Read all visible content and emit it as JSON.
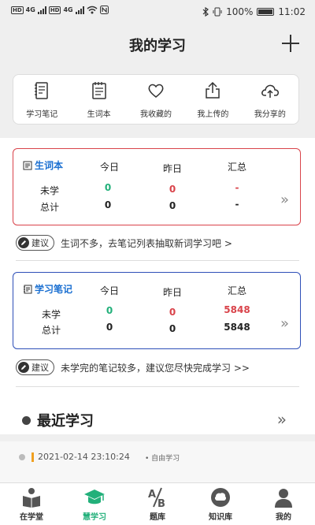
{
  "status_bar": {
    "left_labels": [
      "HD",
      "4G",
      "HD",
      "4G"
    ],
    "battery": "100%",
    "time": "11:02"
  },
  "header": {
    "title": "我的学习",
    "add_icon": "plus-icon"
  },
  "quick_actions": [
    {
      "label": "学习笔记",
      "icon": "notebook-icon"
    },
    {
      "label": "生词本",
      "icon": "vocabulary-icon"
    },
    {
      "label": "我收藏的",
      "icon": "heart-icon"
    },
    {
      "label": "我上传的",
      "icon": "upload-icon"
    },
    {
      "label": "我分享的",
      "icon": "cloud-share-icon"
    }
  ],
  "vocab_card": {
    "title": "生词本",
    "columns": [
      "今日",
      "昨日",
      "汇总"
    ],
    "rows": [
      {
        "label": "未学",
        "values": [
          "0",
          "0",
          "-"
        ]
      },
      {
        "label": "总计",
        "values": [
          "0",
          "0",
          "-"
        ]
      }
    ],
    "accent": "#d9434a"
  },
  "vocab_tip": {
    "badge": "建议",
    "text": "生词不多，去笔记列表抽取新词学习吧 >"
  },
  "notes_card": {
    "title": "学习笔记",
    "columns": [
      "今日",
      "昨日",
      "汇总"
    ],
    "rows": [
      {
        "label": "未学",
        "values": [
          "0",
          "0",
          "5848"
        ]
      },
      {
        "label": "总计",
        "values": [
          "0",
          "0",
          "5848"
        ]
      }
    ],
    "accent": "#2e4fb8"
  },
  "notes_tip": {
    "badge": "建议",
    "text": "未学完的笔记较多，建议您尽快完成学习 >>"
  },
  "recent": {
    "title": "最近学习",
    "entry_time": "2021-02-14 23:10:24",
    "entry_tag": "自由学习"
  },
  "bottom_nav": [
    {
      "label": "在学堂",
      "icon": "reader-icon",
      "active": false
    },
    {
      "label": "慧学习",
      "icon": "graduation-cap-icon",
      "active": true
    },
    {
      "label": "题库",
      "icon": "ab-icon",
      "active": false
    },
    {
      "label": "知识库",
      "icon": "brain-icon",
      "active": false
    },
    {
      "label": "我的",
      "icon": "person-icon",
      "active": false
    }
  ],
  "colors": {
    "green": "#22b07a",
    "red": "#d9434a",
    "link_blue": "#1a6fd1"
  }
}
